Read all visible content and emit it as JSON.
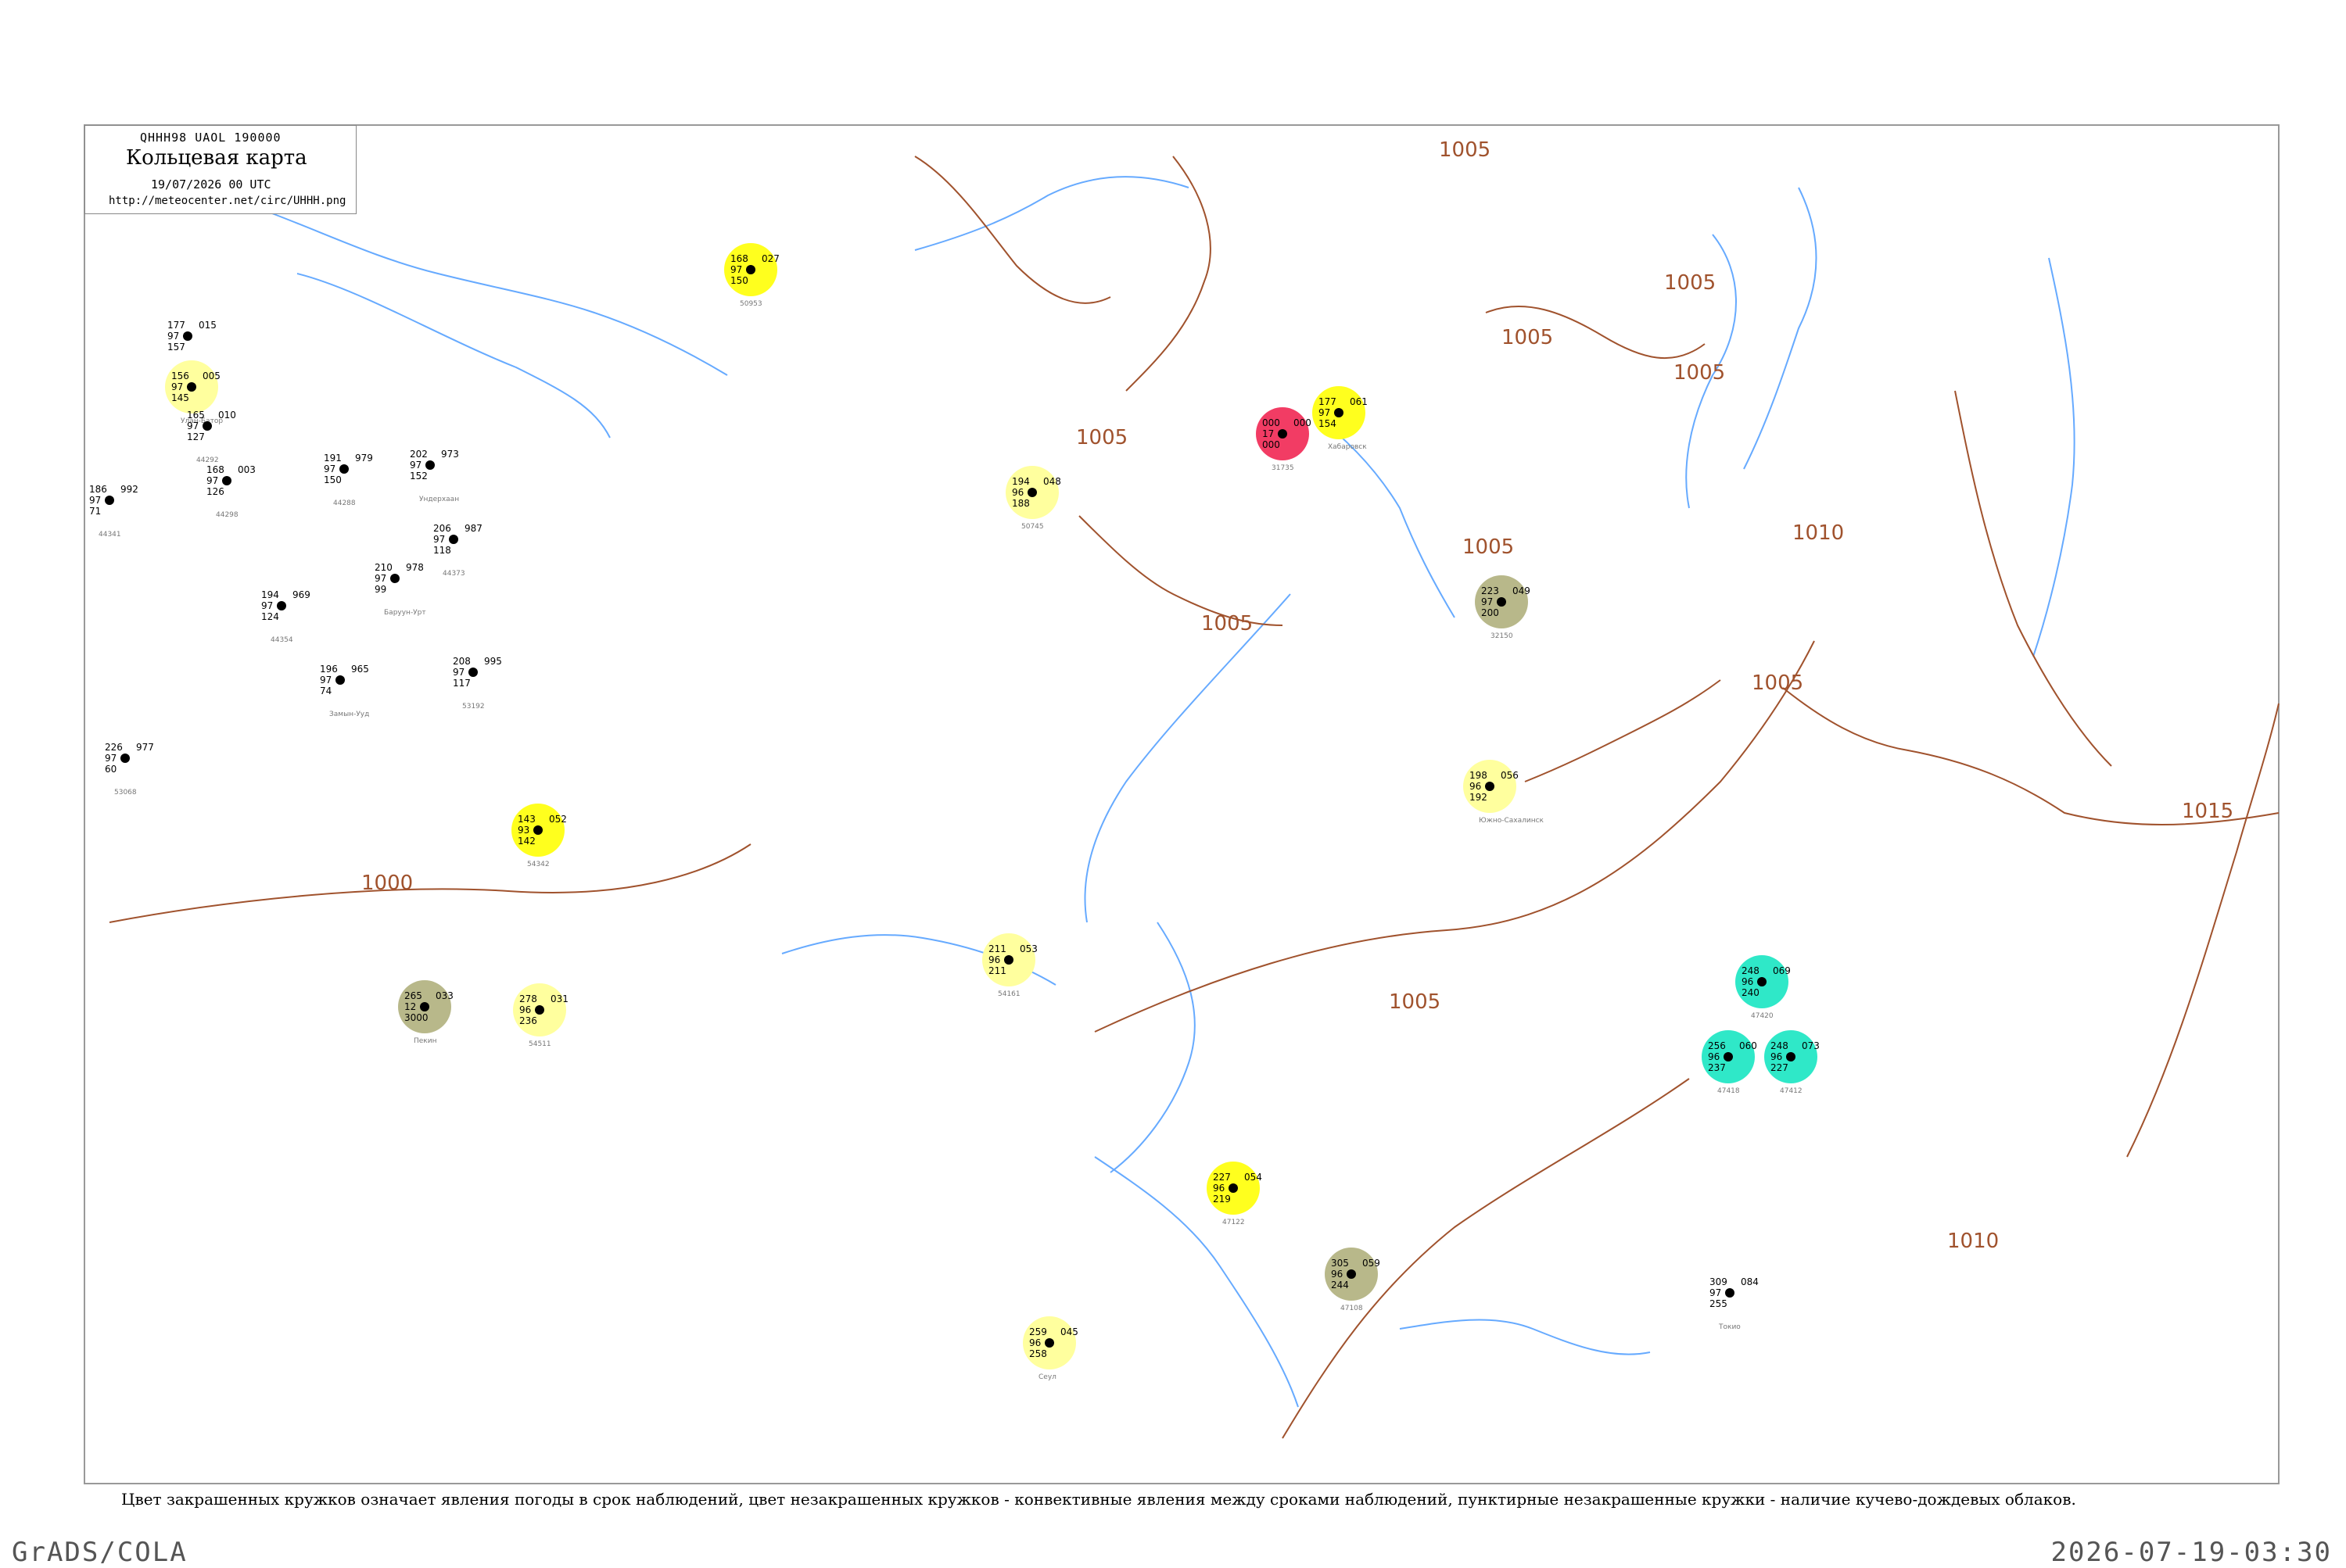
{
  "header": {
    "code": "QHHH98  UAOL  190000",
    "title": "Кольцевая карта",
    "date": "19/07/2026 00 UTC",
    "url": "http://meteocenter.net/circ/UHHH.png"
  },
  "footnote": "Цвет закрашенных кружков означает явления погоды в срок наблюдений, цвет незакрашенных кружков - конвективные явления между сроками наблюдений, пунктирные незакрашенные кружки - наличие кучево-дождевых облаков.",
  "credit": "GrADS/COLA",
  "timestamp": "2026-07-19-03:30",
  "colors": {
    "rain": "#00c12e",
    "fog": "#ffff1e",
    "haze": "#ffff9e",
    "dust": "#b8b88a",
    "thunder": "#f23c64",
    "shower": "#2fe8c8",
    "cb_ring": "#2db04b",
    "isobar": "#a0522d",
    "river": "#66aaff"
  },
  "isobar_labels": [
    "1005",
    "1005",
    "1005",
    "1005",
    "1005",
    "1005",
    "1005",
    "1010",
    "1015",
    "1010",
    "1000",
    "1005",
    "1005"
  ],
  "stations": [
    {
      "name": "44241",
      "t": "177",
      "p": "015",
      "td": "157",
      "w": "97",
      "fill": "none"
    },
    {
      "name": "Улан-Батор",
      "t": "156",
      "p": "005",
      "td": "145",
      "w": "97",
      "fill": "haze"
    },
    {
      "name": "44292",
      "t": "165",
      "p": "010",
      "td": "127",
      "w": "97",
      "fill": "none"
    },
    {
      "name": "44298",
      "t": "168",
      "p": "003",
      "td": "126",
      "w": "97",
      "fill": "none"
    },
    {
      "name": "44341",
      "t": "186",
      "p": "992",
      "td": "71",
      "w": "97",
      "fill": "none"
    },
    {
      "name": "44288",
      "t": "191",
      "p": "979",
      "td": "150",
      "w": "97",
      "fill": "none"
    },
    {
      "name": "Ундерхаан",
      "t": "202",
      "p": "973",
      "td": "152",
      "w": "97",
      "fill": "none"
    },
    {
      "name": "44373",
      "t": "206",
      "p": "987",
      "td": "118",
      "w": "97",
      "fill": "none"
    },
    {
      "name": "Баруун-Урт",
      "t": "210",
      "p": "978",
      "td": "99",
      "w": "97",
      "fill": "none"
    },
    {
      "name": "44354",
      "t": "194",
      "p": "969",
      "td": "124",
      "w": "97",
      "fill": "none"
    },
    {
      "name": "Замын-Ууд",
      "t": "196",
      "p": "965",
      "td": "74",
      "w": "97",
      "fill": "none"
    },
    {
      "name": "53068",
      "t": "226",
      "p": "977",
      "td": "60",
      "w": "97",
      "fill": "none"
    },
    {
      "name": "53192",
      "t": "208",
      "p": "995",
      "td": "117",
      "w": "97",
      "fill": "none"
    },
    {
      "name": "Пекин",
      "t": "265",
      "p": "033",
      "td": "3000",
      "w": "12",
      "fill": "dust"
    },
    {
      "name": "54511",
      "t": "278",
      "p": "031",
      "td": "236",
      "w": "96",
      "fill": "haze"
    },
    {
      "name": "54342",
      "t": "143",
      "p": "052",
      "td": "142",
      "w": "93",
      "fill": "fog"
    },
    {
      "name": "50953",
      "t": "168",
      "p": "027",
      "td": "150",
      "w": "97",
      "fill": "fog"
    },
    {
      "name": "50745",
      "t": "194",
      "p": "048",
      "td": "188",
      "w": "96",
      "fill": "haze"
    },
    {
      "name": "54161",
      "t": "211",
      "p": "053",
      "td": "211",
      "w": "96",
      "fill": "haze"
    },
    {
      "name": "Хабаровск",
      "t": "177",
      "p": "061",
      "td": "154",
      "w": "97",
      "fill": "fog"
    },
    {
      "name": "31735",
      "t": "000",
      "p": "000",
      "td": "000",
      "w": "17",
      "fill": "thunder"
    },
    {
      "name": "Южно-Сахалинск",
      "t": "198",
      "p": "056",
      "td": "192",
      "w": "96",
      "fill": "haze"
    },
    {
      "name": "32150",
      "t": "223",
      "p": "049",
      "td": "200",
      "w": "97",
      "fill": "dust"
    },
    {
      "name": "47122",
      "t": "227",
      "p": "054",
      "td": "219",
      "w": "96",
      "fill": "fog"
    },
    {
      "name": "47108",
      "t": "305",
      "p": "059",
      "td": "244",
      "w": "96",
      "fill": "dust"
    },
    {
      "name": "Сеул",
      "t": "259",
      "p": "045",
      "td": "258",
      "w": "96",
      "fill": "haze"
    },
    {
      "name": "Токио",
      "t": "309",
      "p": "084",
      "td": "255",
      "w": "97",
      "fill": "none"
    },
    {
      "name": "47420",
      "t": "248",
      "p": "069",
      "td": "240",
      "w": "96",
      "fill": "shower"
    },
    {
      "name": "47418",
      "t": "256",
      "p": "060",
      "td": "237",
      "w": "96",
      "fill": "shower"
    },
    {
      "name": "47412",
      "t": "248",
      "p": "073",
      "td": "227",
      "w": "96",
      "fill": "shower"
    }
  ]
}
